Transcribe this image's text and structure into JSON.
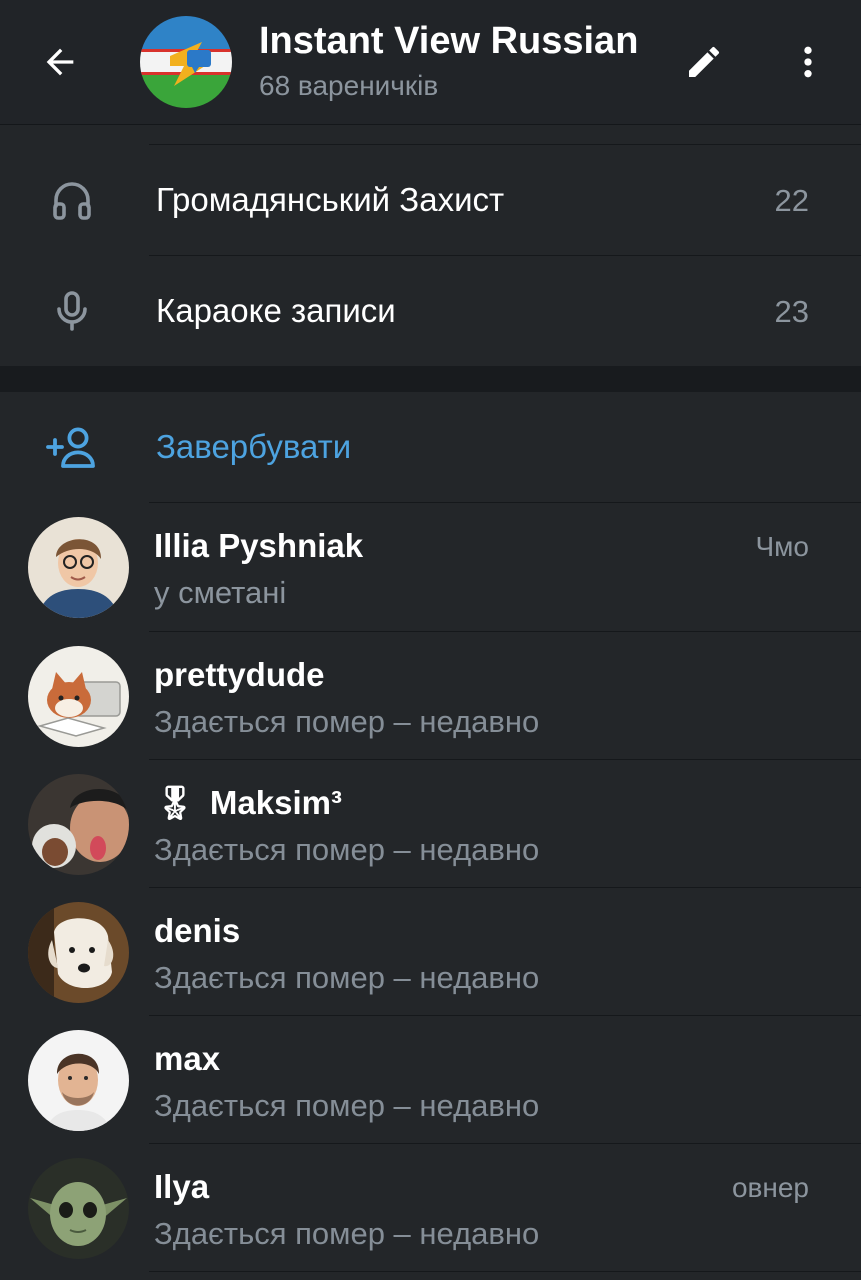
{
  "header": {
    "title": "Instant View Russian",
    "subtitle": "68 вареничків",
    "icons": {
      "back": "arrow-left-icon",
      "edit": "pencil-icon",
      "more": "more-vert-icon"
    }
  },
  "settings": [
    {
      "icon": "headphones-icon",
      "label": "Громадянський Захист",
      "count": "22"
    },
    {
      "icon": "microphone-icon",
      "label": "Караоке записи",
      "count": "23"
    }
  ],
  "invite": {
    "icon": "add-user-icon",
    "label": "Завербувати"
  },
  "members": [
    {
      "name": "Illia Pyshniak",
      "status": "у сметані",
      "role": "Чмо"
    },
    {
      "name": "prettydude",
      "status": "Здається помер – недавно",
      "role": ""
    },
    {
      "name": "Maksim³",
      "badge": "🎖",
      "status": "Здається помер – недавно",
      "role": ""
    },
    {
      "name": "denis",
      "status": "Здається помер – недавно",
      "role": ""
    },
    {
      "name": "max",
      "status": "Здається помер – недавно",
      "role": ""
    },
    {
      "name": "Ilya",
      "status": "Здається помер – недавно",
      "role": "овнер"
    }
  ],
  "colors": {
    "accent": "#4da3e0",
    "background": "#232629",
    "header": "#212428",
    "secondary_text": "#8c959e"
  }
}
